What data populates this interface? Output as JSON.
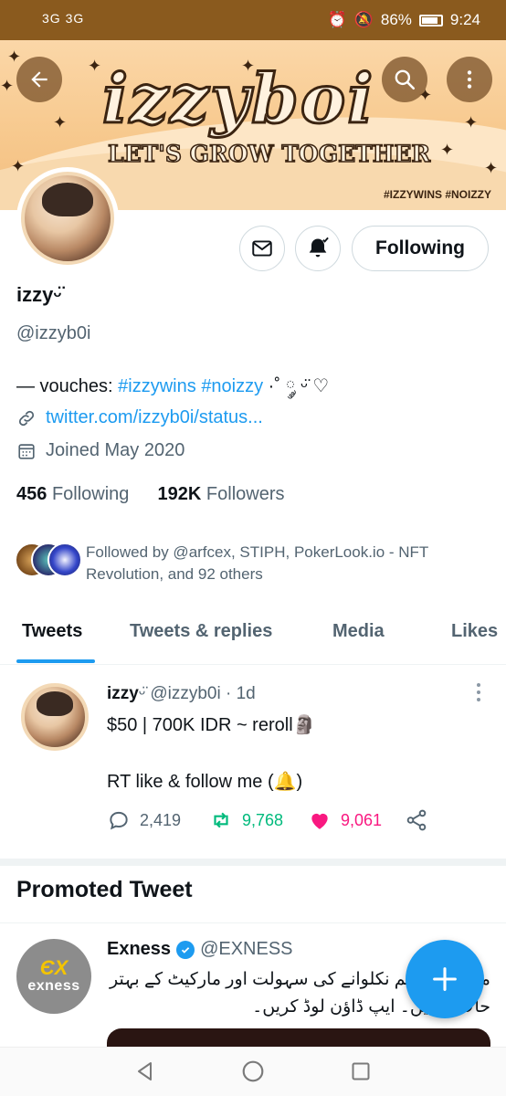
{
  "status_bar": {
    "signal": "3G 3G",
    "battery": "86%",
    "time": "9:24"
  },
  "banner": {
    "title": "izzyboi",
    "subtitle": "LET'S GROW TOGETHER",
    "tags": "#IZZYWINS #NOIZZY"
  },
  "header": {
    "back_icon": "arrow-left-icon",
    "search_icon": "search-icon",
    "more_icon": "more-vertical-icon"
  },
  "profile": {
    "name": "izzy",
    "name_suffix": "ᵕ̈",
    "handle": "@izzyb0i",
    "bio_prefix": "— vouches: ",
    "bio_tag1": "#izzywins",
    "bio_tag2": "#noizzy",
    "bio_suffix": " ·˚ ༘ ᵕ̈ ♡",
    "link": "twitter.com/izzyb0i/status...",
    "joined": "Joined May 2020",
    "following_count": "456",
    "following_label": "Following",
    "followers_count": "192K",
    "followers_label": "Followers",
    "followed_by": "Followed by @arfcex, STIPH, PokerLook.io - NFT Revolution, and 92 others"
  },
  "actions": {
    "following_button": "Following"
  },
  "tabs": [
    "Tweets",
    "Tweets & replies",
    "Media",
    "Likes"
  ],
  "tweet": {
    "name": "izzy",
    "name_suffix": "ᵕ̈",
    "handle": "@izzyb0i",
    "time": "· 1d",
    "line1": "$50 | 700K IDR ~ reroll🗿",
    "line2": "RT like & follow me (🔔)",
    "replies": "2,419",
    "retweets": "9,768",
    "likes": "9,061"
  },
  "promoted": {
    "title": "Promoted Tweet",
    "name": "Exness",
    "handle": "@EXNESS",
    "avatar_mark": "ЄX",
    "avatar_word": "exness",
    "body": "میں فوراً رقم نکلوانے کی سہولت اور مارکیٹ کے بہتر حالات پائیں۔ ایپ ڈاؤن لوڈ کریں۔"
  },
  "colors": {
    "accent": "#1d9bf0",
    "retweet": "#00ba7c",
    "like": "#f91880",
    "status_bar": "#8a5a1e",
    "banner": "#f7c98e"
  }
}
